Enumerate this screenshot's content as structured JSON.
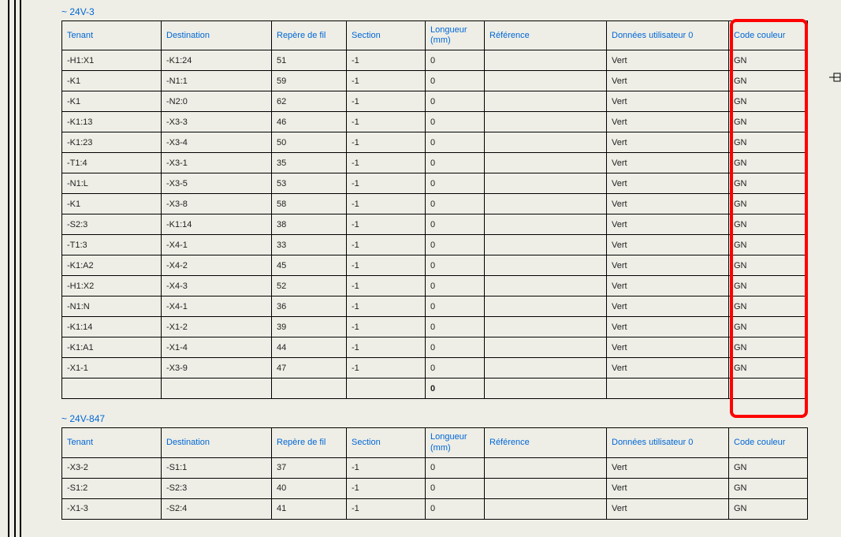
{
  "sections": [
    {
      "title": "~ 24V-3",
      "headers": [
        "Tenant",
        "Destination",
        "Repère de fil",
        "Section",
        "Longueur (mm)",
        "Référence",
        "Données utilisateur 0",
        "Code couleur"
      ],
      "rows": [
        {
          "tenant": "-H1:X1",
          "dest": "-K1:24",
          "rep": "51",
          "sec": "-1",
          "long": "0",
          "ref": "",
          "u0": "Vert",
          "code": "GN"
        },
        {
          "tenant": "-K1",
          "dest": "-N1:1",
          "rep": "59",
          "sec": "-1",
          "long": "0",
          "ref": "",
          "u0": "Vert",
          "code": "GN"
        },
        {
          "tenant": "-K1",
          "dest": "-N2:0",
          "rep": "62",
          "sec": "-1",
          "long": "0",
          "ref": "",
          "u0": "Vert",
          "code": "GN"
        },
        {
          "tenant": "-K1:13",
          "dest": "-X3-3",
          "rep": "46",
          "sec": "-1",
          "long": "0",
          "ref": "",
          "u0": "Vert",
          "code": "GN"
        },
        {
          "tenant": "-K1:23",
          "dest": "-X3-4",
          "rep": "50",
          "sec": "-1",
          "long": "0",
          "ref": "",
          "u0": "Vert",
          "code": "GN"
        },
        {
          "tenant": "-T1:4",
          "dest": "-X3-1",
          "rep": "35",
          "sec": "-1",
          "long": "0",
          "ref": "",
          "u0": "Vert",
          "code": "GN"
        },
        {
          "tenant": "-N1:L",
          "dest": "-X3-5",
          "rep": "53",
          "sec": "-1",
          "long": "0",
          "ref": "",
          "u0": "Vert",
          "code": "GN"
        },
        {
          "tenant": "-K1",
          "dest": "-X3-8",
          "rep": "58",
          "sec": "-1",
          "long": "0",
          "ref": "",
          "u0": "Vert",
          "code": "GN"
        },
        {
          "tenant": "-S2:3",
          "dest": "-K1:14",
          "rep": "38",
          "sec": "-1",
          "long": "0",
          "ref": "",
          "u0": "Vert",
          "code": "GN"
        },
        {
          "tenant": "-T1:3",
          "dest": "-X4-1",
          "rep": "33",
          "sec": "-1",
          "long": "0",
          "ref": "",
          "u0": "Vert",
          "code": "GN"
        },
        {
          "tenant": "-K1:A2",
          "dest": "-X4-2",
          "rep": "45",
          "sec": "-1",
          "long": "0",
          "ref": "",
          "u0": "Vert",
          "code": "GN"
        },
        {
          "tenant": "-H1:X2",
          "dest": "-X4-3",
          "rep": "52",
          "sec": "-1",
          "long": "0",
          "ref": "",
          "u0": "Vert",
          "code": "GN"
        },
        {
          "tenant": "-N1:N",
          "dest": "-X4-1",
          "rep": "36",
          "sec": "-1",
          "long": "0",
          "ref": "",
          "u0": "Vert",
          "code": "GN"
        },
        {
          "tenant": "-K1:14",
          "dest": "-X1-2",
          "rep": "39",
          "sec": "-1",
          "long": "0",
          "ref": "",
          "u0": "Vert",
          "code": "GN"
        },
        {
          "tenant": "-K1:A1",
          "dest": "-X1-4",
          "rep": "44",
          "sec": "-1",
          "long": "0",
          "ref": "",
          "u0": "Vert",
          "code": "GN"
        },
        {
          "tenant": "-X1-1",
          "dest": "-X3-9",
          "rep": "47",
          "sec": "-1",
          "long": "0",
          "ref": "",
          "u0": "Vert",
          "code": "GN"
        }
      ],
      "sum_long": "0"
    },
    {
      "title": "~ 24V-847",
      "headers": [
        "Tenant",
        "Destination",
        "Repère de fil",
        "Section",
        "Longueur (mm)",
        "Référence",
        "Données utilisateur 0",
        "Code couleur"
      ],
      "rows": [
        {
          "tenant": "-X3-2",
          "dest": "-S1:1",
          "rep": "37",
          "sec": "-1",
          "long": "0",
          "ref": "",
          "u0": "Vert",
          "code": "GN"
        },
        {
          "tenant": "-S1:2",
          "dest": "-S2:3",
          "rep": "40",
          "sec": "-1",
          "long": "0",
          "ref": "",
          "u0": "Vert",
          "code": "GN"
        },
        {
          "tenant": "-X1-3",
          "dest": "-S2:4",
          "rep": "41",
          "sec": "-1",
          "long": "0",
          "ref": "",
          "u0": "Vert",
          "code": "GN"
        }
      ],
      "sum_long": null
    }
  ]
}
